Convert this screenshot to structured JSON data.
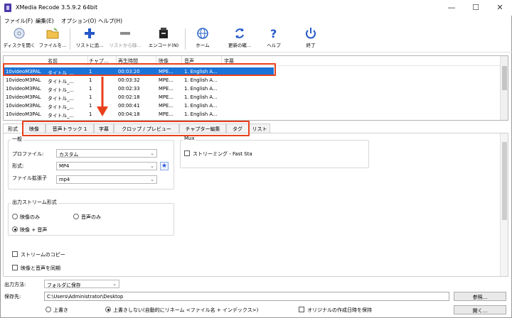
{
  "window": {
    "title": "XMedia Recode 3.5.9.2 64bit",
    "controls": {
      "min": "—",
      "max": "☐",
      "close": "✕"
    }
  },
  "menu": [
    "ファイル(F)",
    "編集(E)",
    "オプション(O)",
    "ヘルプ(H)"
  ],
  "toolbar": [
    {
      "label": "ディスクを開く",
      "icon": "disc-icon"
    },
    {
      "label": "ファイルを...",
      "icon": "folder-open-icon"
    },
    {
      "label": "リストに追...",
      "icon": "plus-icon"
    },
    {
      "label": "リストから除...",
      "icon": "minus-icon"
    },
    {
      "label": "エンコード(N)",
      "icon": "encode-icon"
    },
    {
      "label": "ホーム",
      "icon": "globe-icon"
    },
    {
      "label": "更新の確...",
      "icon": "refresh-icon"
    },
    {
      "label": "ヘルプ",
      "icon": "question-icon"
    },
    {
      "label": "終了",
      "icon": "power-icon"
    }
  ],
  "file_list": {
    "columns": [
      "名前",
      "チャプ...",
      "再生時間",
      "映像",
      "音声",
      "字幕"
    ],
    "rows": [
      [
        "10videoM3PAL",
        "タイトル_...",
        "1",
        "00:03:20",
        "MPE...",
        "1. English A..."
      ],
      [
        "10videoM3PAL",
        "タイトル_...",
        "1",
        "00:03:32",
        "MPE...",
        "1. English A..."
      ],
      [
        "10videoM3PAL",
        "タイトル_...",
        "1",
        "00:02:33",
        "MPE...",
        "1. English A..."
      ],
      [
        "10videoM3PAL",
        "タイトル_...",
        "1",
        "00:02:18",
        "MPE...",
        "1. English A..."
      ],
      [
        "10videoM3PAL",
        "タイトル_...",
        "1",
        "00:00:41",
        "MPE...",
        "1. English A..."
      ],
      [
        "10videoM3PAL",
        "タイトル_...",
        "1",
        "00:04:18",
        "MPE...",
        "1. English A..."
      ]
    ],
    "selected_row": 0
  },
  "tabs": [
    "形式",
    "映像",
    "音声トラック 1",
    "字幕",
    "クロップ / プレビュー",
    "チャプター編集",
    "タグ",
    "リスト"
  ],
  "format_panel": {
    "general_group": "一般",
    "profile_label": "プロファイル:",
    "profile_value": "カスタム",
    "format_label": "形式:",
    "format_value": "MP4",
    "ext_label": "ファイル拡張子",
    "ext_value": "mp4",
    "mux_group": "Mux",
    "streaming_label": "ストリーミング - Fast Sta",
    "stream_group": "出力ストリーム形式",
    "video_only": "映像のみ",
    "audio_only": "音声のみ",
    "video_audio": "映像 + 音声",
    "stream_copy": "ストリームのコピー",
    "sync_av": "映像と音声を同期"
  },
  "bottom": {
    "output_method_label": "出力方法:",
    "output_method_value": "フォルダに保存",
    "save_to_label": "保存先:",
    "save_path": "C:\\Users\\Administrator\\Desktop",
    "browse_button": "参照...",
    "open_button": "開く...",
    "overwrite": "上書き",
    "no_overwrite": "上書きしない(自動的にリネーム <ファイル名 + インデックス>)",
    "keep_date": "オリジナルの作成日時を保持"
  }
}
